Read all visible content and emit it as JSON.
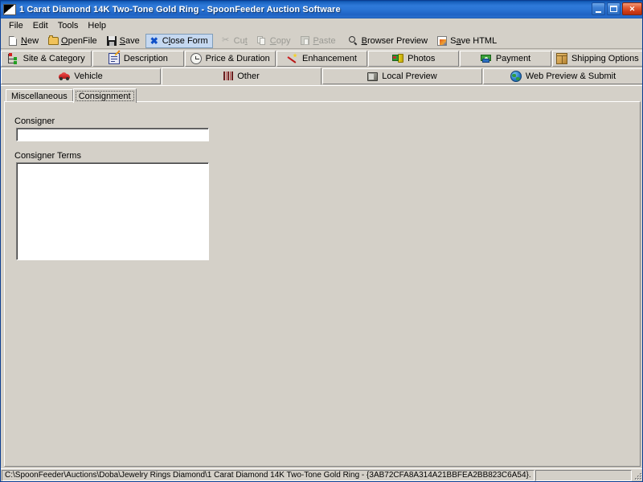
{
  "window": {
    "title": "1 Carat Diamond 14K Two-Tone Gold Ring - SpoonFeeder Auction Software",
    "icon": "app-icon",
    "buttons": {
      "minimize": "minimize-button",
      "maximize": "maximize-button",
      "close": "close-button",
      "close_glyph": "✕"
    }
  },
  "menubar": {
    "items": [
      {
        "label": "File"
      },
      {
        "label": "Edit"
      },
      {
        "label": "Tools"
      },
      {
        "label": "Help"
      }
    ]
  },
  "toolbar": {
    "items": [
      {
        "label": "New",
        "icon": "new-page-icon",
        "enabled": true,
        "active": false
      },
      {
        "label": "OpenFile",
        "icon": "open-folder-icon",
        "enabled": true,
        "active": false
      },
      {
        "label": "Save",
        "icon": "floppy-disk-icon",
        "enabled": true,
        "active": false
      },
      {
        "label": "Close Form",
        "icon": "close-x-icon",
        "enabled": true,
        "active": true
      },
      {
        "label": "Cut",
        "icon": "scissors-icon",
        "enabled": false,
        "active": false
      },
      {
        "label": "Copy",
        "icon": "copy-icon",
        "enabled": false,
        "active": false
      },
      {
        "label": "Paste",
        "icon": "paste-icon",
        "enabled": false,
        "active": false
      },
      {
        "label": "Browser Preview",
        "icon": "magnifier-page-icon",
        "enabled": true,
        "active": false
      },
      {
        "label": "Save HTML",
        "icon": "save-html-icon",
        "enabled": true,
        "active": false
      }
    ]
  },
  "tabs_row1": [
    {
      "label": "Site & Category",
      "icon": "sitemap-icon",
      "selected": false
    },
    {
      "label": "Description",
      "icon": "description-pencil-icon",
      "selected": false
    },
    {
      "label": "Price & Duration",
      "icon": "clock-icon",
      "selected": false
    },
    {
      "label": "Enhancement",
      "icon": "magic-wand-icon",
      "selected": false
    },
    {
      "label": "Photos",
      "icon": "photos-film-icon",
      "selected": false
    },
    {
      "label": "Payment",
      "icon": "payment-money-icon",
      "selected": false
    },
    {
      "label": "Shipping Options",
      "icon": "shipping-box-icon",
      "selected": false
    }
  ],
  "tabs_row2": [
    {
      "label": "Vehicle",
      "icon": "car-icon",
      "selected": false
    },
    {
      "label": "Other",
      "icon": "barcode-icon",
      "selected": true
    },
    {
      "label": "Local Preview",
      "icon": "monitor-icon",
      "selected": false
    },
    {
      "label": "Web Preview & Submit",
      "icon": "globe-icon",
      "selected": false
    }
  ],
  "subtabs": [
    {
      "label": "Miscellaneous",
      "selected": false
    },
    {
      "label": "Consignment",
      "selected": true
    }
  ],
  "form": {
    "consigner": {
      "label": "Consigner",
      "value": "",
      "placeholder": ""
    },
    "consigner_terms": {
      "label": "Consigner Terms",
      "value": "",
      "placeholder": ""
    }
  },
  "statusbar": {
    "path": "C:\\SpoonFeeder\\Auctions\\Doba\\Jewelry Rings Diamond\\1 Carat Diamond 14K Two-Tone Gold Ring - {3AB72CFA8A314A21BBFEA2BB823C6A54}.",
    "secondary": ""
  },
  "colors": {
    "face": "#d4d0c8",
    "title_active": "#2a74d4",
    "highlight": "#c5d8f0",
    "disabled_text": "#9a9a94"
  }
}
